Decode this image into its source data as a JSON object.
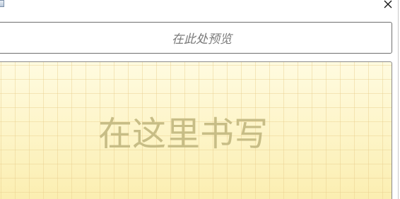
{
  "title_bar": {
    "app_icon": "app-document-icon",
    "close_icon": "close-icon"
  },
  "preview": {
    "placeholder": "在此处预览"
  },
  "writing_pad": {
    "hint": "在这里书写",
    "colors": {
      "pad_top": "#fffbe0",
      "pad_bottom": "#fbeeb0",
      "grid": "#e8cd8c",
      "hint_text": "#c7bd86"
    }
  }
}
